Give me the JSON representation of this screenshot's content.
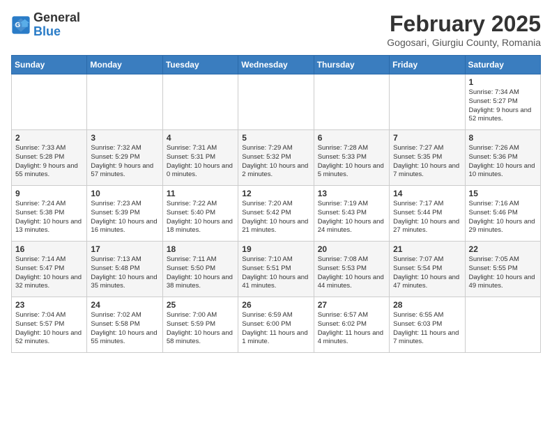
{
  "header": {
    "logo_line1": "General",
    "logo_line2": "Blue",
    "month": "February 2025",
    "location": "Gogosari, Giurgiu County, Romania"
  },
  "weekdays": [
    "Sunday",
    "Monday",
    "Tuesday",
    "Wednesday",
    "Thursday",
    "Friday",
    "Saturday"
  ],
  "weeks": [
    [
      {
        "day": "",
        "info": ""
      },
      {
        "day": "",
        "info": ""
      },
      {
        "day": "",
        "info": ""
      },
      {
        "day": "",
        "info": ""
      },
      {
        "day": "",
        "info": ""
      },
      {
        "day": "",
        "info": ""
      },
      {
        "day": "1",
        "info": "Sunrise: 7:34 AM\nSunset: 5:27 PM\nDaylight: 9 hours and 52 minutes."
      }
    ],
    [
      {
        "day": "2",
        "info": "Sunrise: 7:33 AM\nSunset: 5:28 PM\nDaylight: 9 hours and 55 minutes."
      },
      {
        "day": "3",
        "info": "Sunrise: 7:32 AM\nSunset: 5:29 PM\nDaylight: 9 hours and 57 minutes."
      },
      {
        "day": "4",
        "info": "Sunrise: 7:31 AM\nSunset: 5:31 PM\nDaylight: 10 hours and 0 minutes."
      },
      {
        "day": "5",
        "info": "Sunrise: 7:29 AM\nSunset: 5:32 PM\nDaylight: 10 hours and 2 minutes."
      },
      {
        "day": "6",
        "info": "Sunrise: 7:28 AM\nSunset: 5:33 PM\nDaylight: 10 hours and 5 minutes."
      },
      {
        "day": "7",
        "info": "Sunrise: 7:27 AM\nSunset: 5:35 PM\nDaylight: 10 hours and 7 minutes."
      },
      {
        "day": "8",
        "info": "Sunrise: 7:26 AM\nSunset: 5:36 PM\nDaylight: 10 hours and 10 minutes."
      }
    ],
    [
      {
        "day": "9",
        "info": "Sunrise: 7:24 AM\nSunset: 5:38 PM\nDaylight: 10 hours and 13 minutes."
      },
      {
        "day": "10",
        "info": "Sunrise: 7:23 AM\nSunset: 5:39 PM\nDaylight: 10 hours and 16 minutes."
      },
      {
        "day": "11",
        "info": "Sunrise: 7:22 AM\nSunset: 5:40 PM\nDaylight: 10 hours and 18 minutes."
      },
      {
        "day": "12",
        "info": "Sunrise: 7:20 AM\nSunset: 5:42 PM\nDaylight: 10 hours and 21 minutes."
      },
      {
        "day": "13",
        "info": "Sunrise: 7:19 AM\nSunset: 5:43 PM\nDaylight: 10 hours and 24 minutes."
      },
      {
        "day": "14",
        "info": "Sunrise: 7:17 AM\nSunset: 5:44 PM\nDaylight: 10 hours and 27 minutes."
      },
      {
        "day": "15",
        "info": "Sunrise: 7:16 AM\nSunset: 5:46 PM\nDaylight: 10 hours and 29 minutes."
      }
    ],
    [
      {
        "day": "16",
        "info": "Sunrise: 7:14 AM\nSunset: 5:47 PM\nDaylight: 10 hours and 32 minutes."
      },
      {
        "day": "17",
        "info": "Sunrise: 7:13 AM\nSunset: 5:48 PM\nDaylight: 10 hours and 35 minutes."
      },
      {
        "day": "18",
        "info": "Sunrise: 7:11 AM\nSunset: 5:50 PM\nDaylight: 10 hours and 38 minutes."
      },
      {
        "day": "19",
        "info": "Sunrise: 7:10 AM\nSunset: 5:51 PM\nDaylight: 10 hours and 41 minutes."
      },
      {
        "day": "20",
        "info": "Sunrise: 7:08 AM\nSunset: 5:53 PM\nDaylight: 10 hours and 44 minutes."
      },
      {
        "day": "21",
        "info": "Sunrise: 7:07 AM\nSunset: 5:54 PM\nDaylight: 10 hours and 47 minutes."
      },
      {
        "day": "22",
        "info": "Sunrise: 7:05 AM\nSunset: 5:55 PM\nDaylight: 10 hours and 49 minutes."
      }
    ],
    [
      {
        "day": "23",
        "info": "Sunrise: 7:04 AM\nSunset: 5:57 PM\nDaylight: 10 hours and 52 minutes."
      },
      {
        "day": "24",
        "info": "Sunrise: 7:02 AM\nSunset: 5:58 PM\nDaylight: 10 hours and 55 minutes."
      },
      {
        "day": "25",
        "info": "Sunrise: 7:00 AM\nSunset: 5:59 PM\nDaylight: 10 hours and 58 minutes."
      },
      {
        "day": "26",
        "info": "Sunrise: 6:59 AM\nSunset: 6:00 PM\nDaylight: 11 hours and 1 minute."
      },
      {
        "day": "27",
        "info": "Sunrise: 6:57 AM\nSunset: 6:02 PM\nDaylight: 11 hours and 4 minutes."
      },
      {
        "day": "28",
        "info": "Sunrise: 6:55 AM\nSunset: 6:03 PM\nDaylight: 11 hours and 7 minutes."
      },
      {
        "day": "",
        "info": ""
      }
    ]
  ]
}
